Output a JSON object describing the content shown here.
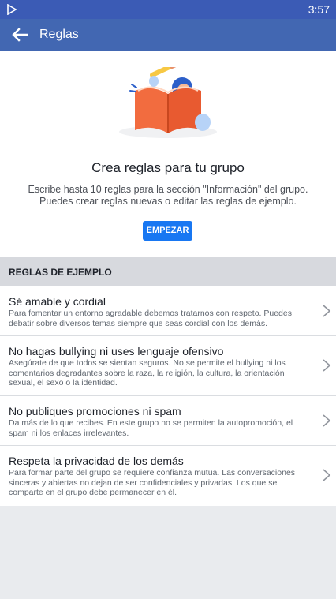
{
  "status_bar": {
    "time": "3:57",
    "app_icon": "play-store-icon"
  },
  "app_bar": {
    "title": "Reglas",
    "back_icon": "back-arrow-icon"
  },
  "hero": {
    "illustration": "book-reading-illustration",
    "heading": "Crea reglas para tu grupo",
    "description_line1": "Escribe hasta 10 reglas para la sección \"Información\" del grupo.",
    "description_line2": "Puedes crear reglas nuevas o editar las reglas de ejemplo.",
    "button_label": "EMPEZAR"
  },
  "section": {
    "title": "REGLAS DE EJEMPLO"
  },
  "rules": [
    {
      "title": "Sé amable y cordial",
      "text": "Para fomentar un entorno agradable debemos tratarnos con respeto. Puedes debatir sobre diversos temas siempre que seas cordial con los demás."
    },
    {
      "title": "No hagas bullying ni uses lenguaje ofensivo",
      "text": "Asegúrate de que todos se sientan seguros. No se permite el bullying ni los comentarios degradantes sobre la raza, la religión, la cultura, la orientación sexual, el sexo o la identidad."
    },
    {
      "title": "No publiques promociones ni spam",
      "text": "Da más de lo que recibes. En este grupo no se permiten la autopromoción, el spam ni los enlaces irrelevantes."
    },
    {
      "title": "Respeta la privacidad de los demás",
      "text": "Para formar parte del grupo se requiere confianza mutua. Las conversaciones sinceras y abiertas no dejan de ser confidenciales y privadas. Los que se comparte en el grupo debe permanecer en él."
    }
  ],
  "colors": {
    "app_bar": "#4267b2",
    "status_bar": "#3b5bb5",
    "button": "#1877f2",
    "section_bg": "#d7d9de"
  }
}
